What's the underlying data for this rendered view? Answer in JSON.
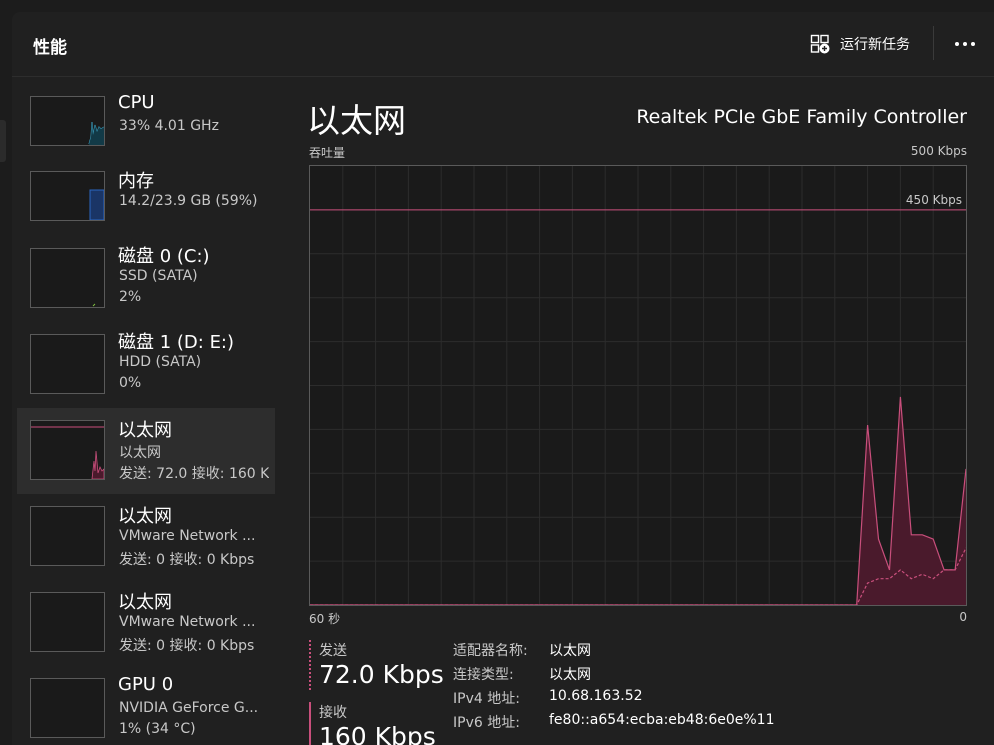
{
  "header": {
    "title": "性能",
    "run_task_label": "运行新任务"
  },
  "sidebar": {
    "items": [
      {
        "name": "CPU",
        "sub": "33% 4.01 GHz",
        "sub2": ""
      },
      {
        "name": "内存",
        "sub": "14.2/23.9 GB (59%)",
        "sub2": ""
      },
      {
        "name": "磁盘 0 (C:)",
        "sub": "SSD (SATA)",
        "sub2": "2%"
      },
      {
        "name": "磁盘 1 (D: E:)",
        "sub": "HDD (SATA)",
        "sub2": "0%"
      },
      {
        "name": "以太网",
        "sub": "以太网",
        "sub2": "发送: 72.0 接收: 160 K"
      },
      {
        "name": "以太网",
        "sub": "VMware Network ...",
        "sub2": "发送: 0 接收: 0 Kbps"
      },
      {
        "name": "以太网",
        "sub": "VMware Network ...",
        "sub2": "发送: 0 接收: 0 Kbps"
      },
      {
        "name": "GPU 0",
        "sub": "NVIDIA GeForce G...",
        "sub2": "1% (34 °C)"
      }
    ],
    "selected_index": 4
  },
  "main": {
    "title": "以太网",
    "adapter": "Realtek PCIe GbE Family Controller",
    "graph": {
      "ylabel": "吞吐量",
      "ymax_label": "500 Kbps",
      "ref_line_label": "450 Kbps",
      "xleft_label": "60 秒",
      "xright_label": "0"
    },
    "send": {
      "label": "发送",
      "value": "72.0 Kbps"
    },
    "receive": {
      "label": "接收",
      "value": "160 Kbps"
    },
    "props": [
      {
        "key": "适配器名称:",
        "value": "以太网"
      },
      {
        "key": "连接类型:",
        "value": "以太网"
      },
      {
        "key": "IPv4 地址:",
        "value": "10.68.163.52"
      },
      {
        "key": "IPv6 地址:",
        "value": "fe80::a654:ecba:eb48:6e0e%11"
      }
    ]
  },
  "chart_data": {
    "type": "area",
    "ylim": [
      0,
      500
    ],
    "x_range_seconds": [
      60,
      0
    ],
    "reference_line": 450,
    "series": [
      {
        "name": "接收",
        "style": "solid",
        "x": [
          60,
          10,
          9,
          8,
          7,
          6,
          5,
          4,
          3,
          2,
          1,
          0
        ],
        "values": [
          0,
          0,
          205,
          75,
          40,
          237,
          80,
          80,
          75,
          40,
          40,
          155
        ]
      },
      {
        "name": "发送",
        "style": "dashed",
        "x": [
          60,
          10,
          9,
          8,
          7,
          6,
          5,
          4,
          3,
          2,
          1,
          0
        ],
        "values": [
          0,
          0,
          25,
          30,
          30,
          40,
          30,
          35,
          30,
          40,
          40,
          65
        ]
      }
    ],
    "grid": true
  },
  "colors": {
    "accent": "#c94f7c",
    "fill": "#4a1a2c",
    "cpu_line": "#3fa7c9",
    "memory_fill": "#2a66c2"
  }
}
